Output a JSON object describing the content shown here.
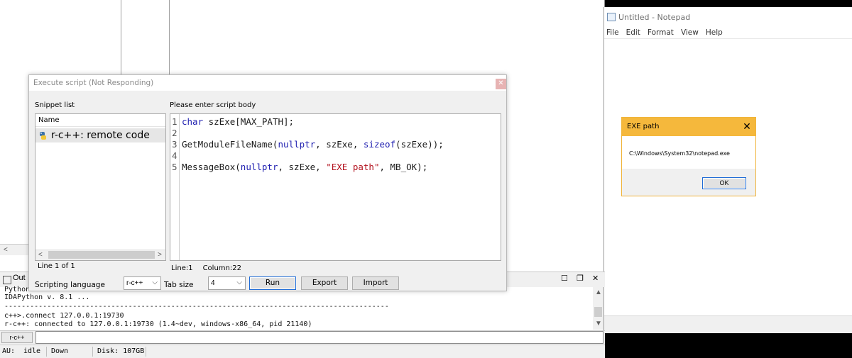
{
  "notepad": {
    "title": "Untitled - Notepad",
    "menu": [
      "File",
      "Edit",
      "Format",
      "View",
      "Help"
    ]
  },
  "msgbox": {
    "title": "EXE path",
    "text": "C:\\Windows\\System32\\notepad.exe",
    "ok": "OK"
  },
  "dialog": {
    "title": "Execute script (Not Responding)",
    "snippet_list_label": "Snippet list",
    "script_body_label": "Please enter script body",
    "column_header": "Name",
    "snippet_item": "r-c++: remote code",
    "snippet_status": "Line 1 of 1",
    "line_numbers": [
      "1",
      "2",
      "3",
      "4",
      "5"
    ],
    "code": {
      "l1_kw": "char",
      "l1_rest": " szExe[MAX_PATH];",
      "l3_a": "GetModuleFileName(",
      "l3_kw1": "nullptr",
      "l3_b": ", szExe, ",
      "l3_kw2": "sizeof",
      "l3_c": "(szExe));",
      "l5_a": "MessageBox(",
      "l5_kw": "nullptr",
      "l5_b": ", szExe, ",
      "l5_str": "\"EXE path\"",
      "l5_c": ", MB_OK);"
    },
    "line_label": "Line:1",
    "column_label": "Column:22",
    "scripting_language_label": "Scripting language",
    "scripting_language_value": "r-c++",
    "tab_size_label": "Tab size",
    "tab_size_value": "4",
    "run": "Run",
    "export": "Export",
    "import": "Import"
  },
  "output": {
    "tab_label": "Out",
    "lines": [
      "Python",
      "IDAPython v. 8.1 ...                                            ",
      "------------------------------------------------------------------------------------------",
      "c++>.connect 127.0.0.1:19730",
      "r-c++: connected to 127.0.0.1:19730 (1.4~dev, windows-x86_64, pid 21140)"
    ],
    "input_label": "r-c++"
  },
  "statusbar": {
    "au": "AU:",
    "state": "idle",
    "dir": "Down",
    "disk": "Disk: 107GB"
  }
}
